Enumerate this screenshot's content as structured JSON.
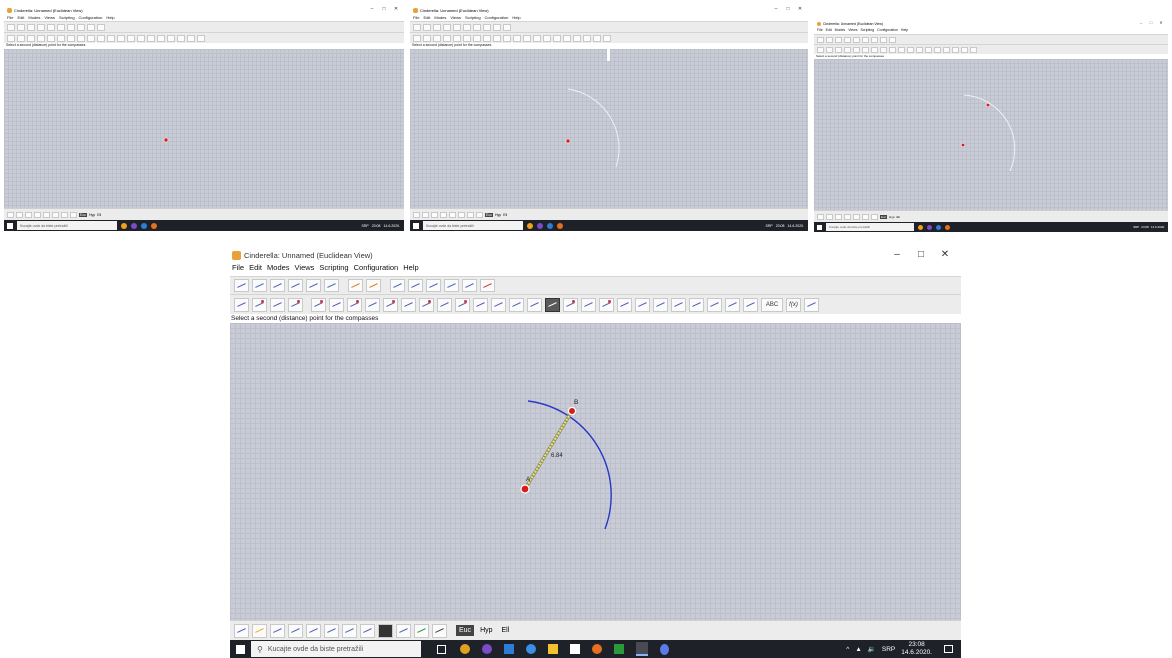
{
  "window": {
    "title": "Cinderella: Unnamed (Euclidean View)",
    "controls": [
      "–",
      "□",
      "✕"
    ]
  },
  "menu": [
    "File",
    "Edit",
    "Modes",
    "Views",
    "Scripting",
    "Configuration",
    "Help"
  ],
  "status_message": "Select a second (distance) point for the compasses",
  "geometry": {
    "point_a_label": "A",
    "point_b_label": "B",
    "distance_label": "6.84"
  },
  "bottom_toolbar": {
    "view_buttons": [
      "Euc",
      "Hyp",
      "Ell"
    ]
  },
  "taskbar": {
    "search_placeholder": "Kucajte ovde da biste pretražili",
    "language": "SRP",
    "time": "23:08",
    "date": "14.6.2020."
  },
  "colors": {
    "canvas": "#c9ccd6",
    "circle_arc": "#2a35c9",
    "point_fill": "#d81b1b",
    "segment": "#e8e36a",
    "taskbar": "#1f2128"
  },
  "icons": {
    "app": "cinderella-app-icon",
    "search": "search-icon",
    "windows": "windows-start-icon"
  }
}
